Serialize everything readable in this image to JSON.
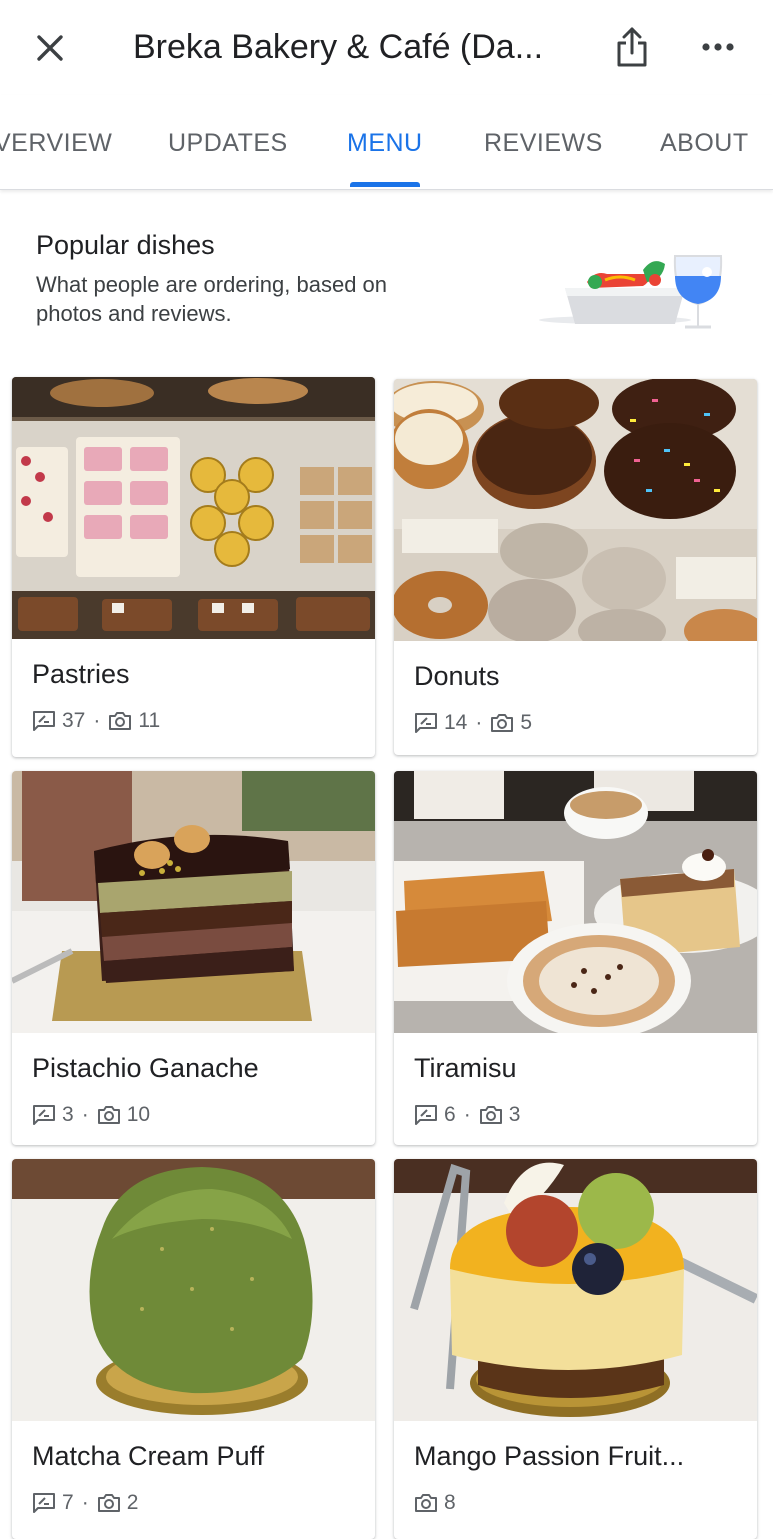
{
  "header": {
    "title": "Breka Bakery & Café (Da...",
    "close_icon": "close-icon",
    "share_icon": "share-icon",
    "more_icon": "more-horizontal-icon"
  },
  "tabs": [
    {
      "label": "VERVIEW"
    },
    {
      "label": "UPDATES"
    },
    {
      "label": "MENU",
      "active": true
    },
    {
      "label": "REVIEWS"
    },
    {
      "label": "ABOUT"
    }
  ],
  "popular": {
    "title": "Popular dishes",
    "subtitle_line1": "What people are ordering, based on",
    "subtitle_line2": "photos and reviews."
  },
  "colors": {
    "accent": "#1a73e8",
    "text_secondary": "#5f6368"
  },
  "dishes": [
    {
      "name": "Pastries",
      "reviews": "37",
      "photos": "11"
    },
    {
      "name": "Donuts",
      "reviews": "14",
      "photos": "5"
    },
    {
      "name": "Pistachio Ganache",
      "reviews": "3",
      "photos": "10"
    },
    {
      "name": "Tiramisu",
      "reviews": "6",
      "photos": "3"
    },
    {
      "name": "Matcha Cream Puff",
      "reviews": "7",
      "photos": "2"
    },
    {
      "name": "Mango Passion Fruit...",
      "photos": "8"
    }
  ],
  "separator": "·"
}
